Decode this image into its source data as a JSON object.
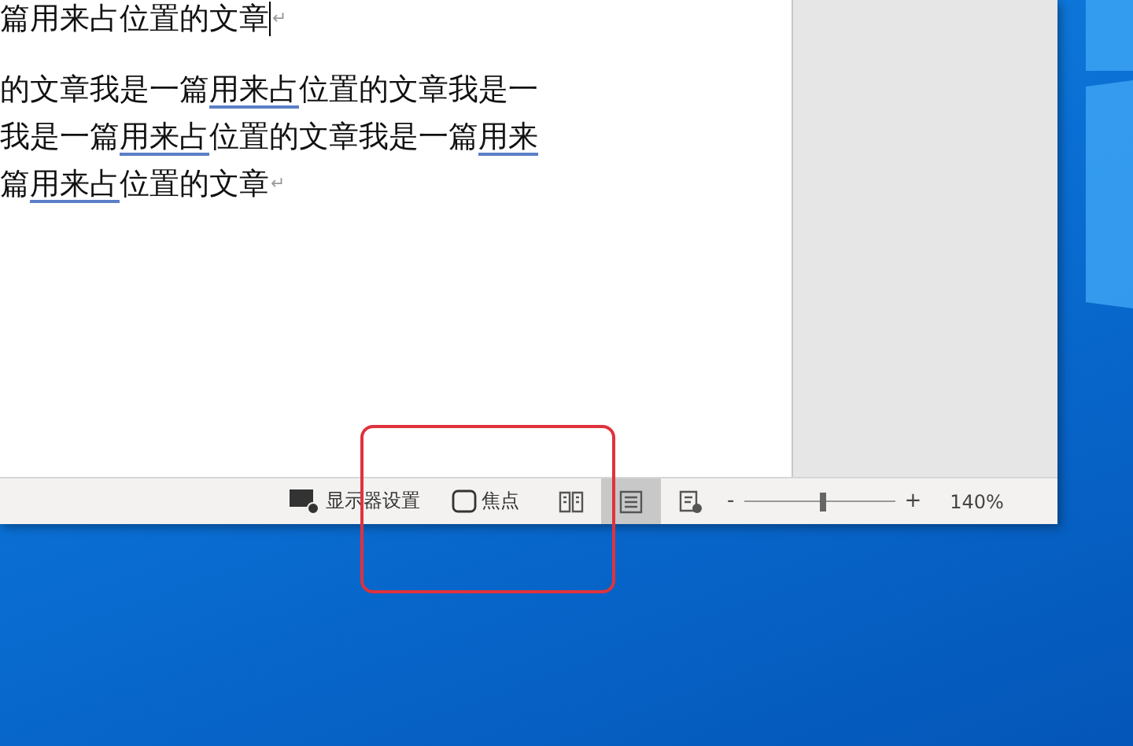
{
  "document": {
    "lines": [
      {
        "segments": [
          {
            "text": "篇用来占位置的文章",
            "underlined": false
          }
        ],
        "caret": true,
        "paragraph_mark": "↵"
      },
      {
        "segments": [
          {
            "text": "的文章我是一篇",
            "underlined": false
          },
          {
            "text": "用来占",
            "underlined": true
          },
          {
            "text": "位置的文章我是一",
            "underlined": false
          }
        ],
        "caret": false
      },
      {
        "segments": [
          {
            "text": "我是一篇",
            "underlined": false
          },
          {
            "text": "用来占",
            "underlined": true
          },
          {
            "text": "位置的文章我是一篇",
            "underlined": false
          },
          {
            "text": "用来",
            "underlined": true
          }
        ],
        "caret": false
      },
      {
        "segments": [
          {
            "text": "篇",
            "underlined": false
          },
          {
            "text": "用来占",
            "underlined": true
          },
          {
            "text": "位置的文章",
            "underlined": false
          }
        ],
        "caret": false,
        "paragraph_mark": "↵"
      }
    ]
  },
  "status_bar": {
    "display_settings": "显示器设置",
    "focus": "焦点",
    "views": [
      {
        "kind": "read",
        "selected": false
      },
      {
        "kind": "print",
        "selected": true
      },
      {
        "kind": "web",
        "selected": false
      }
    ],
    "zoom": {
      "minus": "-",
      "plus": "+",
      "level": 0.52,
      "reading": "140%"
    }
  },
  "annotation": {
    "shown": true
  }
}
